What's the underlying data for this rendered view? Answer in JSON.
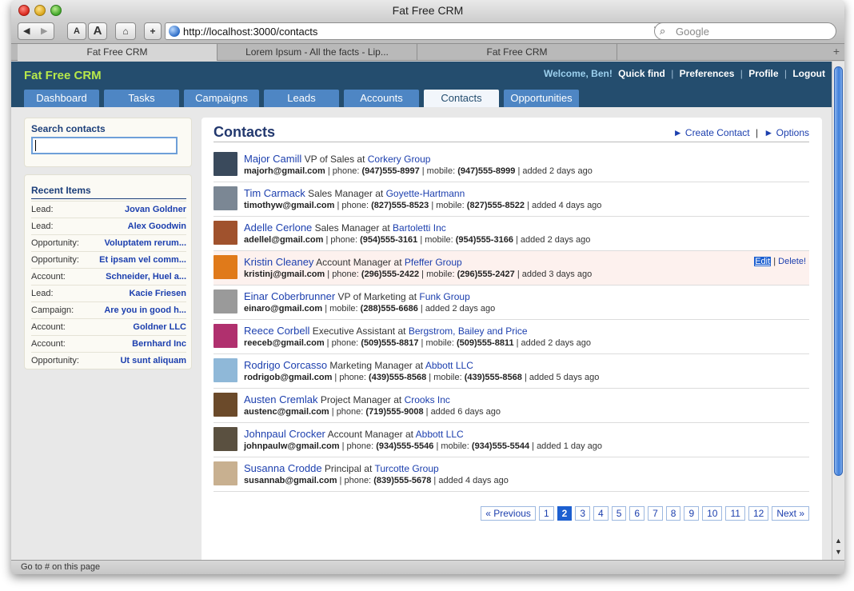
{
  "browser": {
    "window_title": "Fat Free CRM",
    "url": "http://localhost:3000/contacts",
    "search_placeholder": "Google",
    "tabs": [
      "Fat Free CRM",
      "Lorem Ipsum - All the facts - Lip...",
      "Fat Free CRM"
    ],
    "status": "Go to # on this page",
    "text_small": "A",
    "text_large": "A"
  },
  "app": {
    "brand": "Fat Free CRM",
    "welcome": "Welcome, Ben!",
    "header_links": [
      "Quick find",
      "Preferences",
      "Profile",
      "Logout"
    ],
    "nav": [
      "Dashboard",
      "Tasks",
      "Campaigns",
      "Leads",
      "Accounts",
      "Contacts",
      "Opportunities"
    ],
    "active_nav": "Contacts"
  },
  "sidebar": {
    "search_title": "Search contacts",
    "search_value": "",
    "recent_title": "Recent Items",
    "recent": [
      {
        "type": "Lead:",
        "name": "Jovan Goldner"
      },
      {
        "type": "Lead:",
        "name": "Alex Goodwin"
      },
      {
        "type": "Opportunity:",
        "name": "Voluptatem rerum..."
      },
      {
        "type": "Opportunity:",
        "name": "Et ipsam vel comm..."
      },
      {
        "type": "Account:",
        "name": "Schneider, Huel a..."
      },
      {
        "type": "Lead:",
        "name": "Kacie Friesen"
      },
      {
        "type": "Campaign:",
        "name": "Are you in good h..."
      },
      {
        "type": "Account:",
        "name": "Goldner LLC"
      },
      {
        "type": "Account:",
        "name": "Bernhard Inc"
      },
      {
        "type": "Opportunity:",
        "name": "Ut sunt aliquam"
      }
    ]
  },
  "main": {
    "title": "Contacts",
    "create_label": "► Create Contact",
    "options_label": "► Options",
    "edit_label": "Edit",
    "delete_label": "Delete!",
    "contacts": [
      {
        "name": "Major Camill",
        "title": "VP of Sales",
        "company": "Corkery Group",
        "email": "majorh@gmail.com",
        "phone": "(947)555-8997",
        "mobile": "(947)555-8999",
        "added": "added 2 days ago",
        "avatar_color": "#3a4a5c"
      },
      {
        "name": "Tim Carmack",
        "title": "Sales Manager",
        "company": "Goyette-Hartmann",
        "email": "timothyw@gmail.com",
        "phone": "(827)555-8523",
        "mobile": "(827)555-8522",
        "added": "added 4 days ago",
        "avatar_color": "#7b8794"
      },
      {
        "name": "Adelle Cerlone",
        "title": "Sales Manager",
        "company": "Bartoletti Inc",
        "email": "adellel@gmail.com",
        "phone": "(954)555-3161",
        "mobile": "(954)555-3166",
        "added": "added 2 days ago",
        "avatar_color": "#a0522d"
      },
      {
        "name": "Kristin Cleaney",
        "title": "Account Manager",
        "company": "Pfeffer Group",
        "email": "kristinj@gmail.com",
        "phone": "(296)555-2422",
        "mobile": "(296)555-2427",
        "added": "added 3 days ago",
        "avatar_color": "#e07a1a"
      },
      {
        "name": "Einar Coberbrunner",
        "title": "VP of Marketing",
        "company": "Funk Group",
        "email": "einaro@gmail.com",
        "phone": "",
        "mobile": "(288)555-6686",
        "added": "added 2 days ago",
        "avatar_color": "#9a9a9a"
      },
      {
        "name": "Reece Corbell",
        "title": "Executive Assistant",
        "company": "Bergstrom, Bailey and Price",
        "email": "reeceb@gmail.com",
        "phone": "(509)555-8817",
        "mobile": "(509)555-8811",
        "added": "added 2 days ago",
        "avatar_color": "#b0306e"
      },
      {
        "name": "Rodrigo Corcasso",
        "title": "Marketing Manager",
        "company": "Abbott LLC",
        "email": "rodrigob@gmail.com",
        "phone": "(439)555-8568",
        "mobile": "(439)555-8568",
        "added": "added 5 days ago",
        "avatar_color": "#8fb8d8"
      },
      {
        "name": "Austen Cremlak",
        "title": "Project Manager",
        "company": "Crooks Inc",
        "email": "austenc@gmail.com",
        "phone": "(719)555-9008",
        "mobile": "",
        "added": "added 6 days ago",
        "avatar_color": "#6b4a2a"
      },
      {
        "name": "Johnpaul Crocker",
        "title": "Account Manager",
        "company": "Abbott LLC",
        "email": "johnpaulw@gmail.com",
        "phone": "(934)555-5546",
        "mobile": "(934)555-5544",
        "added": "added 1 day ago",
        "avatar_color": "#5a5040"
      },
      {
        "name": "Susanna Crodde",
        "title": "Principal",
        "company": "Turcotte Group",
        "email": "susannab@gmail.com",
        "phone": "(839)555-5678",
        "mobile": "",
        "added": "added 4 days ago",
        "avatar_color": "#c8b090"
      }
    ],
    "pager": [
      "« Previous",
      "1",
      "2",
      "3",
      "4",
      "5",
      "6",
      "7",
      "8",
      "9",
      "10",
      "11",
      "12",
      "Next »"
    ],
    "current_page": "2"
  },
  "labels": {
    "at": "at",
    "phone": "phone:",
    "mobile": "mobile:",
    "sep": "|"
  }
}
